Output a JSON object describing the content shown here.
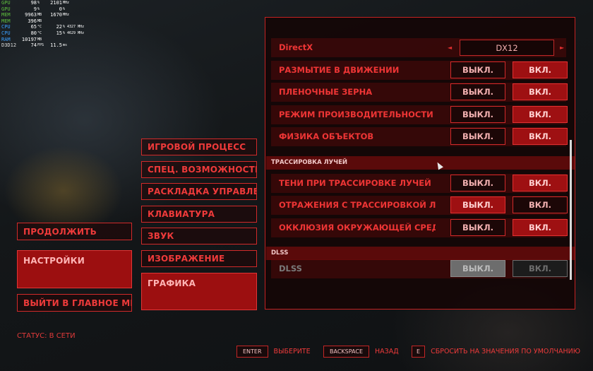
{
  "overlay": [
    {
      "label": "GPU",
      "label_color": "green",
      "v1": "98",
      "u1": "%",
      "v2": "2101",
      "u2": "MHz"
    },
    {
      "label": "GPU",
      "label_color": "green",
      "v1": "9",
      "u1": "%",
      "v2": "0",
      "u2": "%"
    },
    {
      "label": "MEM",
      "label_color": "green",
      "v1": "9963",
      "u1": "MB",
      "v2": "1670",
      "u2": "MHz"
    },
    {
      "label": "MEM",
      "label_color": "green",
      "v1": "396",
      "u1": "MB",
      "v2": "",
      "u2": ""
    },
    {
      "label": "CPU",
      "label_color": "blue",
      "v1": "65",
      "u1": "°C",
      "v2": "22",
      "u2": "% 4327 MHz"
    },
    {
      "label": "CPU",
      "label_color": "blue",
      "v1": "80",
      "u1": "°C",
      "v2": "15",
      "u2": "% 4629 MHz"
    },
    {
      "label": "RAM",
      "label_color": "blue",
      "v1": "10197",
      "u1": "MB",
      "v2": "",
      "u2": ""
    },
    {
      "label": "D3D12",
      "label_color": "white",
      "v1": "74",
      "u1": "FPS",
      "v2": "11.5",
      "u2": "ms"
    }
  ],
  "left_menu": {
    "continue": "ПРОДОЛЖИТЬ",
    "settings": "НАСТРОЙКИ",
    "exit": "ВЫЙТИ В ГЛАВНОЕ МЕН"
  },
  "categories": [
    "ИГРОВОЙ ПРОЦЕСС",
    "СПЕЦ. ВОЗМОЖНОСТИ",
    "РАСКЛАДКА УПРАВЛЕН",
    "КЛАВИАТУРА",
    "ЗВУК",
    "ИЗОБРАЖЕНИЕ",
    "ГРАФИКА"
  ],
  "status": "СТАТУС: В СЕТИ",
  "panel": {
    "directx": {
      "label": "DirectX",
      "value": "DX12",
      "left_arrow": "◄",
      "right_arrow": "►"
    },
    "rows_top": [
      {
        "label": "РАЗМЫТИЕ В ДВИЖЕНИИ",
        "off": "ВЫКЛ.",
        "on": "ВКЛ.",
        "selected": "on"
      },
      {
        "label": "ПЛЕНОЧНЫЕ ЗЕРНА",
        "off": "ВЫКЛ.",
        "on": "ВКЛ.",
        "selected": "on"
      },
      {
        "label": "РЕЖИМ ПРОИЗВОДИТЕЛЬНОСТИ ПР",
        "off": "ВЫКЛ.",
        "on": "ВКЛ.",
        "selected": "on"
      },
      {
        "label": "ФИЗИКА ОБЪЕКТОВ",
        "off": "ВЫКЛ.",
        "on": "ВКЛ.",
        "selected": "on"
      }
    ],
    "section_rt": "ТРАССИРОВКА ЛУЧЕЙ",
    "rows_rt": [
      {
        "label": "ТЕНИ ПРИ ТРАССИРОВКЕ ЛУЧЕЙ",
        "off": "ВЫКЛ.",
        "on": "ВКЛ.",
        "selected": "on"
      },
      {
        "label": "ОТРАЖЕНИЯ С ТРАССИРОВКОЙ ЛУЧ",
        "off": "ВЫКЛ.",
        "on": "ВКЛ.",
        "selected": "off"
      },
      {
        "label": "ОККЛЮЗИЯ ОКРУЖАЮЩЕЙ СРЕДЫ",
        "off": "ВЫКЛ.",
        "on": "ВКЛ.",
        "selected": "on"
      }
    ],
    "section_dlss": "DLSS",
    "row_dlss": {
      "label": "DLSS",
      "off": "ВЫКЛ.",
      "on": "ВКЛ.",
      "selected": "off",
      "disabled": true
    }
  },
  "footer": {
    "enter_key": "ENTER",
    "enter_label": "ВЫБЕРИТЕ",
    "back_key": "BACKSPACE",
    "back_label": "НАЗАД",
    "reset_key": "E",
    "reset_label": "СБРОСИТЬ НА ЗНАЧЕНИЯ ПО УМОЛЧАНИЮ"
  }
}
